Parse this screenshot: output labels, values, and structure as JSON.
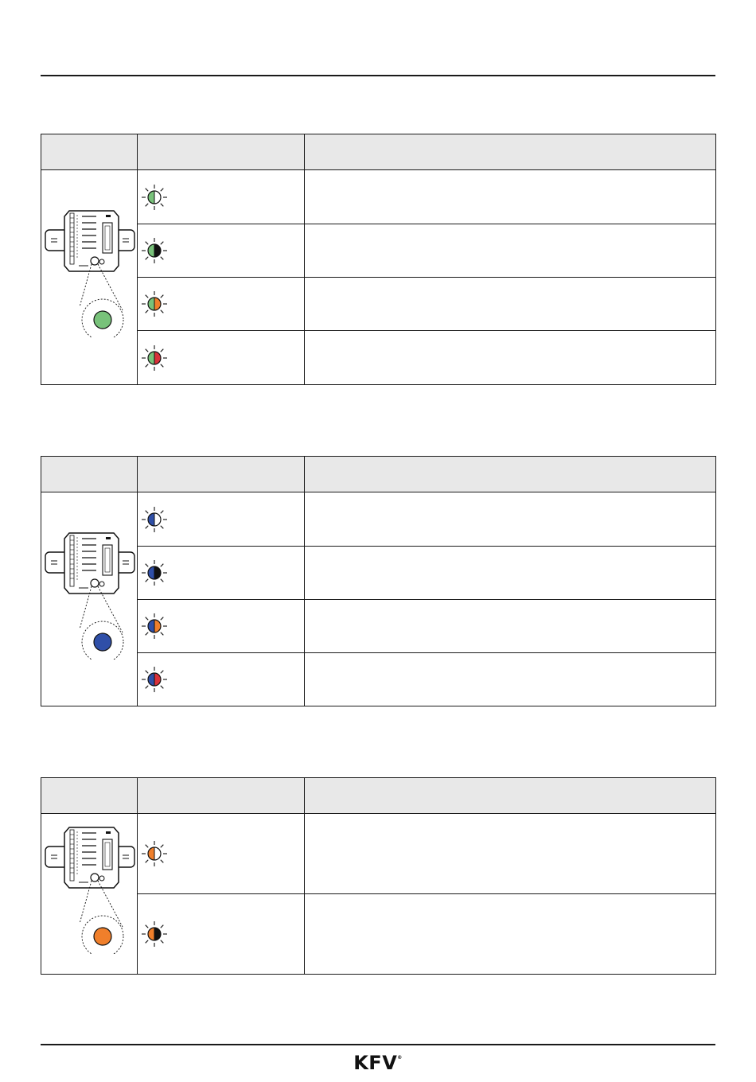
{
  "colors": {
    "green": "#78c27a",
    "blue": "#2f4fa8",
    "orange": "#f07f2b",
    "red": "#d9313a",
    "black": "#111111",
    "white": "#ffffff",
    "header_bg": "#e8e8e8"
  },
  "tables": [
    {
      "base_color": "green",
      "headers": [
        "",
        "",
        ""
      ],
      "rows": [
        {
          "led": "green/white",
          "description": ""
        },
        {
          "led": "green/black",
          "description": ""
        },
        {
          "led": "green/orange",
          "description": ""
        },
        {
          "led": "green/red",
          "description": ""
        }
      ]
    },
    {
      "base_color": "blue",
      "headers": [
        "",
        "",
        ""
      ],
      "rows": [
        {
          "led": "blue/white",
          "description": ""
        },
        {
          "led": "blue/black",
          "description": ""
        },
        {
          "led": "blue/orange",
          "description": ""
        },
        {
          "led": "blue/red",
          "description": ""
        }
      ]
    },
    {
      "base_color": "orange",
      "headers": [
        "",
        "",
        ""
      ],
      "rows": [
        {
          "led": "orange/white",
          "description": ""
        },
        {
          "led": "orange/black",
          "description": ""
        }
      ]
    }
  ],
  "footer": {
    "logo_text": "KFV",
    "logo_mark": "®"
  }
}
